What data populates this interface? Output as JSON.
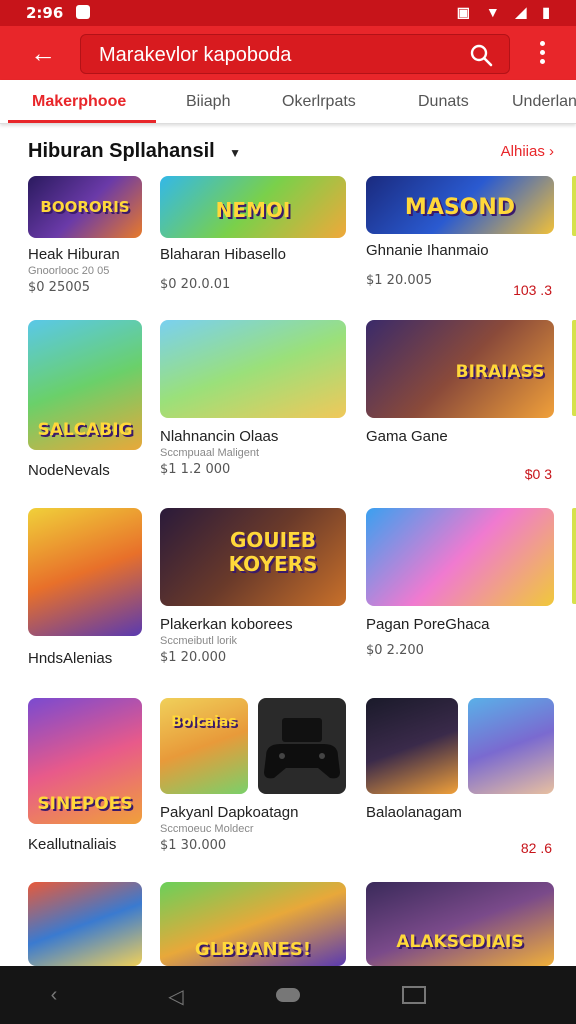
{
  "status_bar": {
    "time": "2:96"
  },
  "app_bar": {
    "search_text": "Marakevlor kapoboda"
  },
  "tabs": [
    {
      "label": "Makerphooe"
    },
    {
      "label": "Biiaph"
    },
    {
      "label": "Okerlrpats"
    },
    {
      "label": "Dunats"
    },
    {
      "label": "Underlan"
    }
  ],
  "section": {
    "title": "Hiburan Spllahansil",
    "see_all": "Alhiias"
  },
  "colors": {
    "brand": "#e8262a",
    "status": "#c7141a",
    "price_rating": "#c7141a"
  },
  "cards": [
    {
      "label": "BOORORIS",
      "name": "Heak Hiburan",
      "sub": "Gnoorlooc 20 05",
      "price": "$0 25005",
      "rating": ""
    },
    {
      "label": "NEMOI",
      "name": "Blaharan Hibasello",
      "sub": "",
      "price": "$0 20.0.01",
      "rating": ""
    },
    {
      "label": "MASOND",
      "name": "Ghnanie Ihanmaio",
      "sub": "",
      "price": "$1 20.005",
      "rating": "103 .3"
    },
    {
      "label": "SALCABIG",
      "name": "",
      "sub": "",
      "price": "",
      "rating": ""
    },
    {
      "label": "",
      "name": "Nlahnancin Olaas",
      "sub": "Sccmpuaal Maligent",
      "price": "$1 1.2 000",
      "rating": ""
    },
    {
      "label": "BIRAIASS",
      "name": "Gama Gane",
      "sub": "",
      "price": "",
      "rating": "$0 3"
    },
    {
      "label": "",
      "name": "",
      "sub": "",
      "price": "",
      "rating": ""
    },
    {
      "label": "GOUIEB KOYERS",
      "name": "Plakerkan koborees",
      "sub": "Sccmeibutl lorik",
      "price": "$1 20.000",
      "rating": ""
    },
    {
      "label": "",
      "name": "Pagan PoreGhaca",
      "sub": "",
      "price": "$0 2.200",
      "rating": ""
    },
    {
      "label": "SINEPOES",
      "name": "",
      "sub": "",
      "price": "",
      "rating": ""
    },
    {
      "label": "Bolcaias",
      "name": "Pakyanl Dapkoatagn",
      "sub": "Sccmoeuc Moldecr",
      "price": "$1 30.000",
      "rating": ""
    },
    {
      "label": "",
      "name": "Balaolanagam",
      "sub": "",
      "price": "",
      "rating": "82 .6"
    },
    {
      "label": "",
      "name": "",
      "sub": "",
      "price": "",
      "rating": ""
    },
    {
      "label": "GLBBANES!",
      "name": "",
      "sub": "",
      "price": "",
      "rating": ""
    },
    {
      "label": "ALAKSCDIAIS",
      "name": "",
      "sub": "",
      "price": "",
      "rating": ""
    }
  ],
  "left_row_labels": [
    "NodeNevals",
    "HndsAlenias",
    "Keallutnaliais"
  ]
}
